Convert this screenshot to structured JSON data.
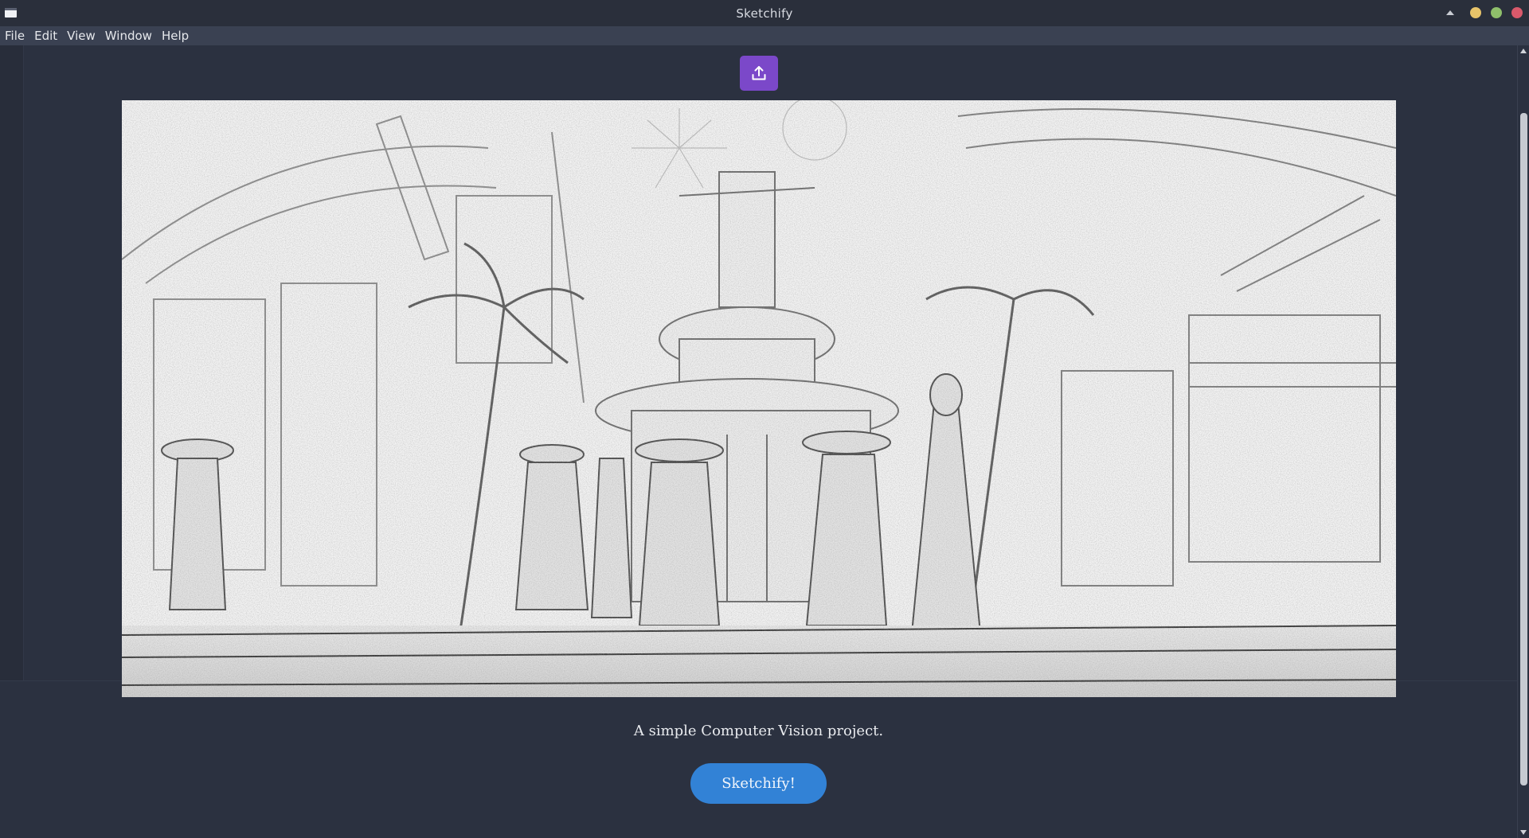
{
  "window": {
    "title": "Sketchify",
    "controls": [
      "minimize",
      "maximize",
      "close"
    ],
    "control_colors": {
      "minimize": "#e8c46a",
      "maximize": "#8fbf6b",
      "close": "#d9596b"
    }
  },
  "menubar": {
    "items": [
      {
        "label": "File"
      },
      {
        "label": "Edit"
      },
      {
        "label": "View"
      },
      {
        "label": "Window"
      },
      {
        "label": "Help"
      }
    ]
  },
  "toolbar": {
    "upload_icon": "upload-icon",
    "upload_color": "#7b48c9"
  },
  "main": {
    "preview_image": "pencil-sketch-of-fantasy-street-scene",
    "caption": "A simple Computer Vision project.",
    "action_button_label": "Sketchify!",
    "action_button_color": "#3282d6"
  }
}
